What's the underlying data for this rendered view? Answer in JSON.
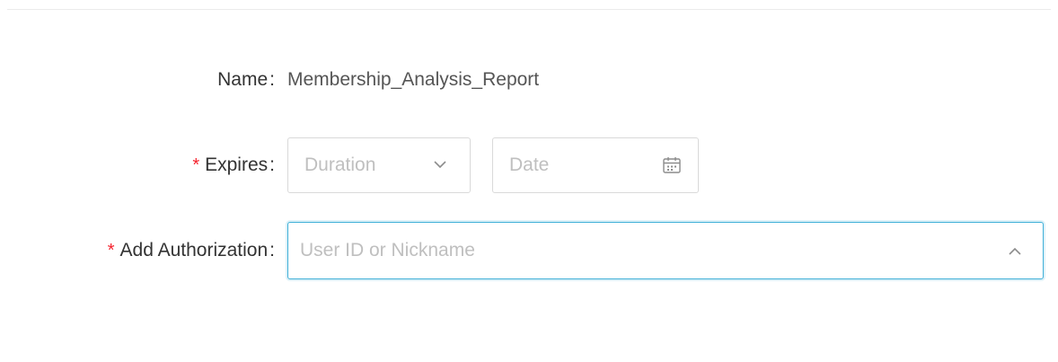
{
  "form": {
    "name": {
      "label": "Name",
      "colon": ":",
      "value": "Membership_Analysis_Report"
    },
    "expires": {
      "required_mark": "*",
      "label": "Expires",
      "colon": ":",
      "duration_placeholder": "Duration",
      "date_placeholder": "Date"
    },
    "authorization": {
      "required_mark": "*",
      "label": "Add Authorization",
      "colon": ":",
      "placeholder": "User ID or Nickname"
    }
  },
  "icons": {
    "duration_dropdown": "chevron-down-icon",
    "date_picker": "calendar-icon",
    "authorization_dropdown": "chevron-up-icon"
  },
  "colors": {
    "required": "#f5222d",
    "focus_border": "#40b0d8"
  }
}
